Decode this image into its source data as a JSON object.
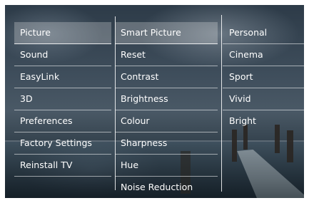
{
  "menu_main": {
    "items": [
      "Picture",
      "Sound",
      "EasyLink",
      "3D",
      "Preferences",
      "Factory Settings",
      "Reinstall TV"
    ],
    "selected_index": 0
  },
  "menu_picture": {
    "items": [
      "Smart Picture",
      "Reset",
      "Contrast",
      "Brightness",
      "Colour",
      "Sharpness",
      "Hue",
      "Noise Reduction"
    ],
    "selected_index": 0
  },
  "menu_smart_picture": {
    "items": [
      "Personal",
      "Cinema",
      "Sport",
      "Vivid",
      "Bright"
    ]
  }
}
